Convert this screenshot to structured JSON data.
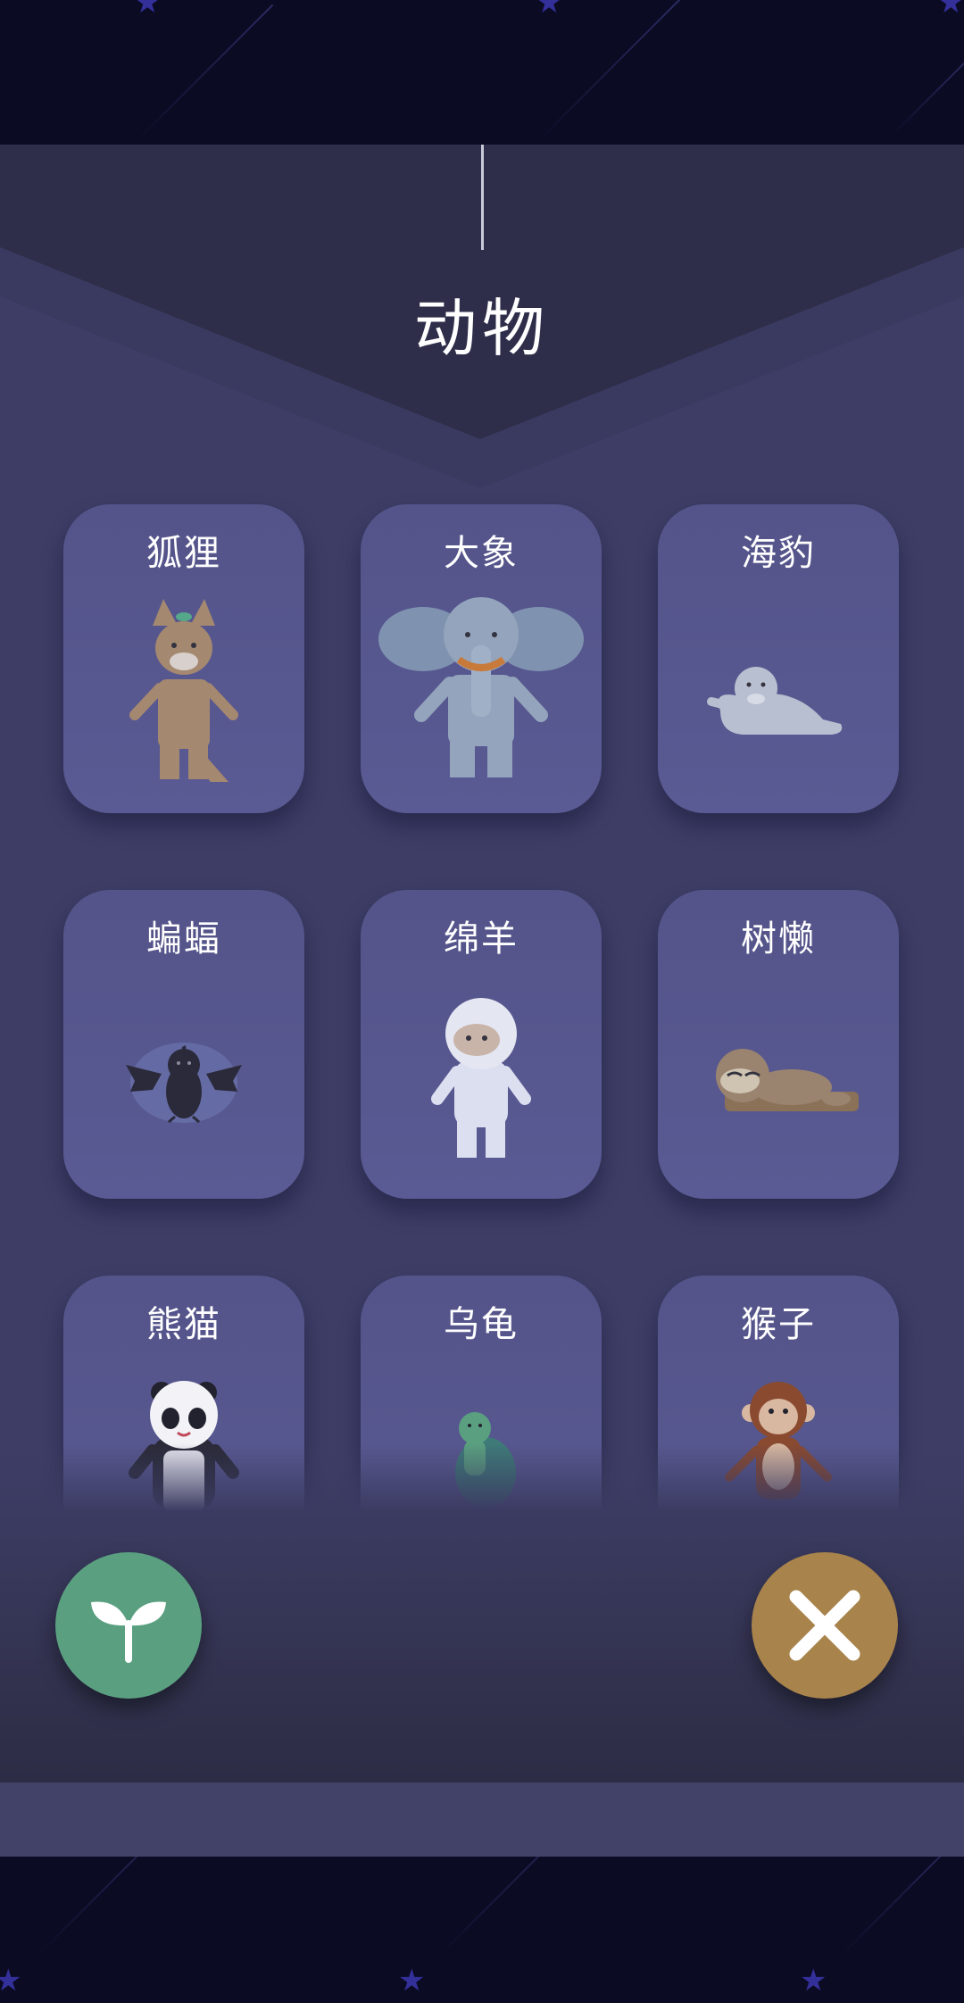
{
  "category_title": "动物",
  "animals": [
    {
      "label": "狐狸",
      "icon": "fox-icon"
    },
    {
      "label": "大象",
      "icon": "elephant-icon"
    },
    {
      "label": "海豹",
      "icon": "seal-icon"
    },
    {
      "label": "蝙蝠",
      "icon": "bat-icon"
    },
    {
      "label": "绵羊",
      "icon": "sheep-icon"
    },
    {
      "label": "树懒",
      "icon": "sloth-icon"
    },
    {
      "label": "熊猫",
      "icon": "panda-icon"
    },
    {
      "label": "乌龟",
      "icon": "turtle-icon"
    },
    {
      "label": "猴子",
      "icon": "monkey-icon"
    }
  ],
  "buttons": {
    "plant": {
      "icon": "sprout-icon",
      "color": "#5aa080"
    },
    "close": {
      "icon": "close-icon",
      "color": "#a8834b"
    }
  },
  "colors": {
    "background": "#0b0b24",
    "panel": "#3d3d66",
    "card": "#5a5a94",
    "star": "#34309a"
  }
}
